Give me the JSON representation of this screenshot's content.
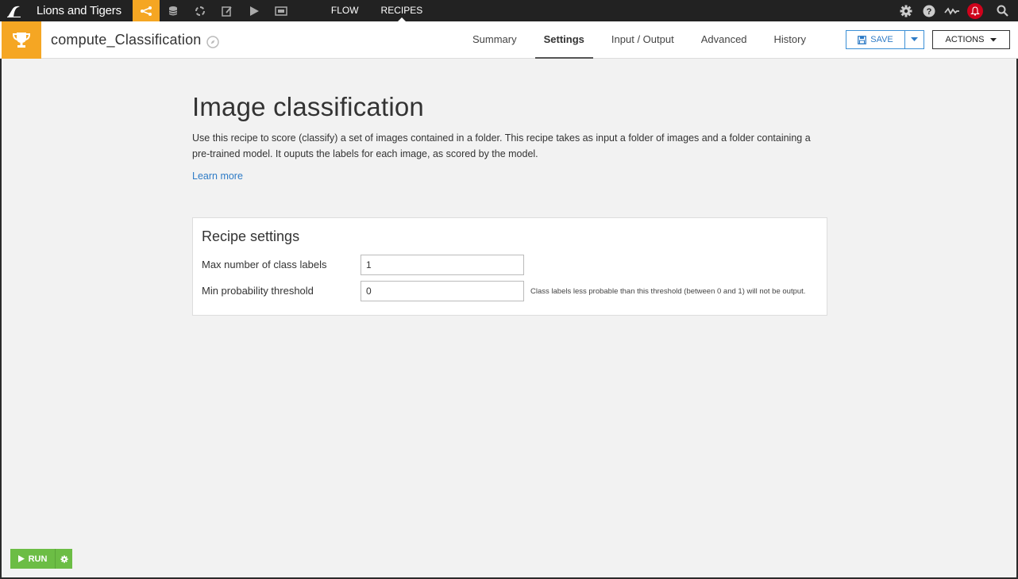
{
  "topbar": {
    "project_name": "Lions and Tigers",
    "nav_items": [
      {
        "label": "FLOW"
      },
      {
        "label": "RECIPES"
      }
    ],
    "icons": [
      "dataiku-bird-logo",
      "flow-icon",
      "datasets-icon",
      "cycle-icon",
      "notebook-icon",
      "play-icon",
      "dashboard-icon",
      "gear-icon",
      "help-icon",
      "activity-icon",
      "bell-icon",
      "search-icon"
    ]
  },
  "header": {
    "recipe_name": "compute_Classification",
    "tabs": [
      {
        "label": "Summary"
      },
      {
        "label": "Settings",
        "active": true
      },
      {
        "label": "Input / Output"
      },
      {
        "label": "Advanced"
      },
      {
        "label": "History"
      }
    ],
    "save_label": "SAVE",
    "actions_label": "ACTIONS"
  },
  "main": {
    "title": "Image classification",
    "description": "Use this recipe to score (classify) a set of images contained in a folder. This recipe takes as input a folder of images and a folder containing a pre-trained model. It ouputs the labels for each image, as scored by the model.",
    "learn_more": "Learn more",
    "settings": {
      "title": "Recipe settings",
      "fields": [
        {
          "label": "Max number of class labels",
          "value": "1"
        },
        {
          "label": "Min probability threshold",
          "value": "0",
          "help": "Class labels less probable than this threshold (between 0 and 1) will not be output."
        }
      ]
    },
    "run_label": "RUN"
  },
  "colors": {
    "accent": "#f5a623",
    "primary_blue": "#2e7bc6",
    "run_green": "#6cbd45",
    "notification_red": "#d0021b"
  }
}
